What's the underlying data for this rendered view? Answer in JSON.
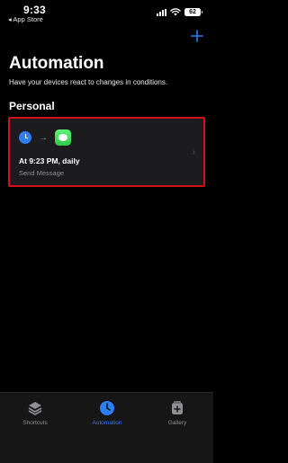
{
  "status_bar": {
    "time": "9:33",
    "back_app": "◂ App Store",
    "battery": "62"
  },
  "header": {
    "title": "Automation",
    "subtitle": "Have your devices react to changes in conditions."
  },
  "section": {
    "title": "Personal"
  },
  "automation": {
    "title": "At 9:23 PM, daily",
    "subtitle": "Send Message",
    "trigger_icon": "clock-icon",
    "action_icon": "messages-icon"
  },
  "tab_bar": {
    "tabs": [
      {
        "label": "Shortcuts",
        "icon": "shortcuts-icon",
        "active": false
      },
      {
        "label": "Automation",
        "icon": "automation-icon",
        "active": true
      },
      {
        "label": "Gallery",
        "icon": "gallery-icon",
        "active": false
      }
    ]
  },
  "colors": {
    "accent": "#2d7df6",
    "highlight_border": "#d0101b",
    "card_bg": "#1c1c1e"
  }
}
